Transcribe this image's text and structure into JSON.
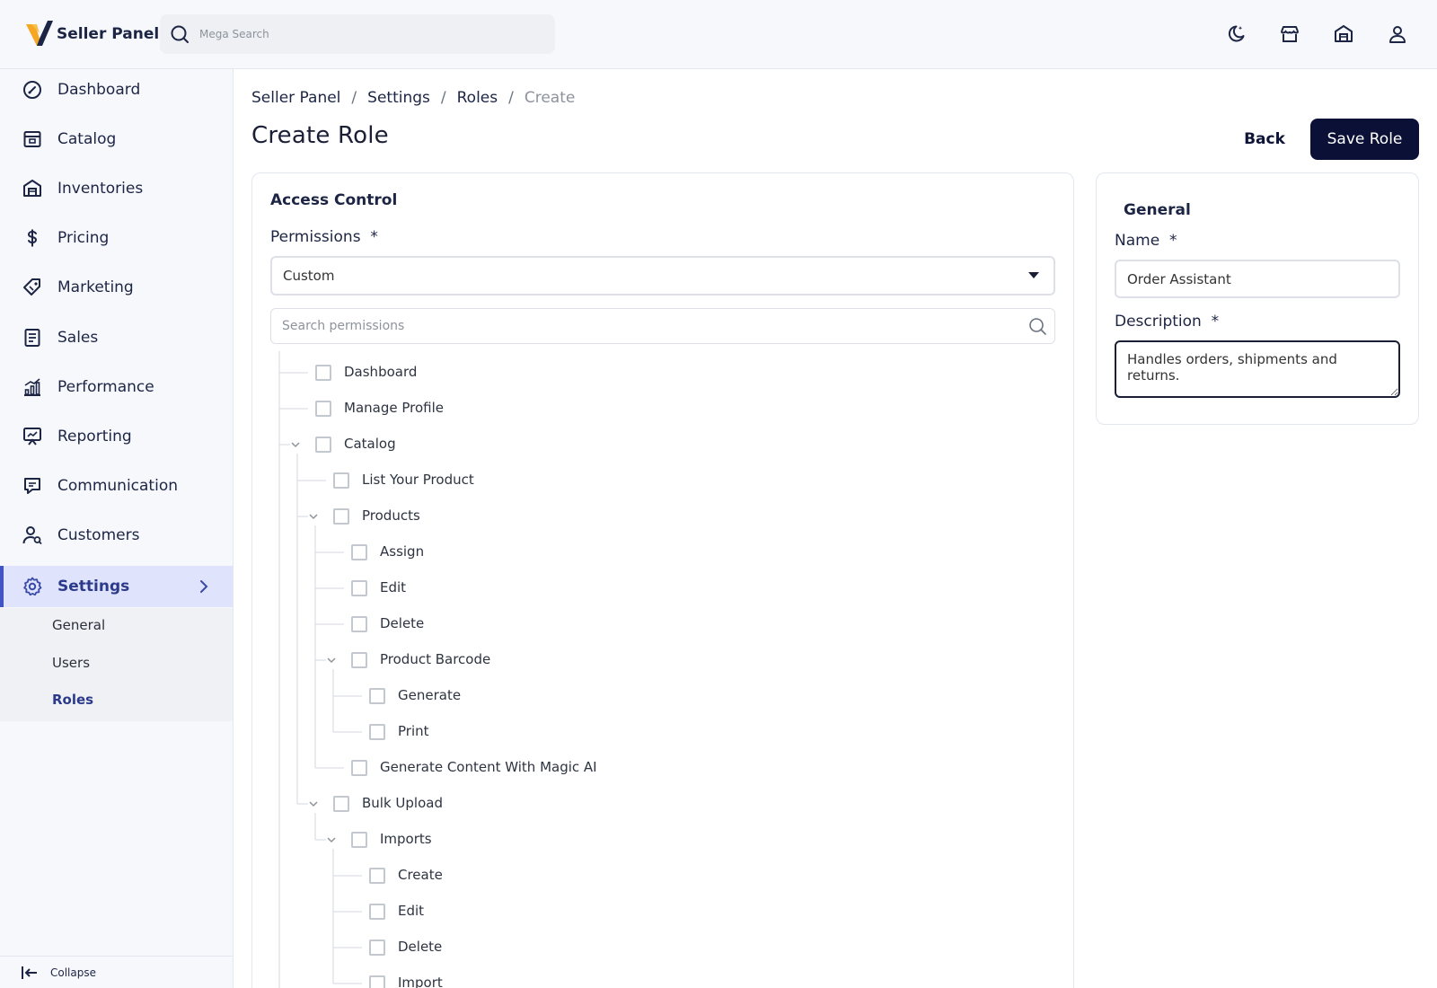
{
  "app": {
    "name": "Seller Panel"
  },
  "search": {
    "placeholder": "Mega Search"
  },
  "header_icons": [
    "moon-icon",
    "store-icon",
    "warehouse-icon",
    "user-icon"
  ],
  "colors": {
    "primary": "#0b1136",
    "accent": "#4154c4",
    "active_bg": "#dfe3fb"
  },
  "sidebar": {
    "items": [
      {
        "label": "Dashboard",
        "icon": "gauge-icon"
      },
      {
        "label": "Catalog",
        "icon": "catalog-icon"
      },
      {
        "label": "Inventories",
        "icon": "warehouse-icon"
      },
      {
        "label": "Pricing",
        "icon": "dollar-icon"
      },
      {
        "label": "Marketing",
        "icon": "tag-icon"
      },
      {
        "label": "Sales",
        "icon": "receipt-icon"
      },
      {
        "label": "Performance",
        "icon": "bar-chart-icon"
      },
      {
        "label": "Reporting",
        "icon": "presentation-icon"
      },
      {
        "label": "Communication",
        "icon": "chat-icon"
      },
      {
        "label": "Customers",
        "icon": "users-icon"
      },
      {
        "label": "Settings",
        "icon": "gear-icon",
        "active": true
      }
    ],
    "sub_items": [
      {
        "label": "General"
      },
      {
        "label": "Users"
      },
      {
        "label": "Roles",
        "active": true
      }
    ],
    "collapse_label": "Collapse"
  },
  "breadcrumb": [
    "Seller Panel",
    "Settings",
    "Roles",
    "Create"
  ],
  "page": {
    "title": "Create Role",
    "back_label": "Back",
    "save_label": "Save Role"
  },
  "access_control": {
    "title": "Access Control",
    "permissions_label": "Permissions",
    "required_mark": "*",
    "permissions_value": "Custom",
    "search_placeholder": "Search permissions",
    "tree": [
      {
        "label": "Dashboard",
        "depth": 0
      },
      {
        "label": "Manage Profile",
        "depth": 0
      },
      {
        "label": "Catalog",
        "depth": 0,
        "expanded": true
      },
      {
        "label": "List Your Product",
        "depth": 1
      },
      {
        "label": "Products",
        "depth": 1,
        "expanded": true
      },
      {
        "label": "Assign",
        "depth": 2
      },
      {
        "label": "Edit",
        "depth": 2
      },
      {
        "label": "Delete",
        "depth": 2
      },
      {
        "label": "Product Barcode",
        "depth": 2,
        "expanded": true
      },
      {
        "label": "Generate",
        "depth": 3
      },
      {
        "label": "Print",
        "depth": 3
      },
      {
        "label": "Generate Content With Magic AI",
        "depth": 2
      },
      {
        "label": "Bulk Upload",
        "depth": 1,
        "expanded": true
      },
      {
        "label": "Imports",
        "depth": 2,
        "expanded": true
      },
      {
        "label": "Create",
        "depth": 3
      },
      {
        "label": "Edit",
        "depth": 3
      },
      {
        "label": "Delete",
        "depth": 3
      },
      {
        "label": "Import",
        "depth": 3
      }
    ]
  },
  "general": {
    "title": "General",
    "name_label": "Name",
    "name_value": "Order Assistant",
    "description_label": "Description",
    "description_value": "Handles orders, shipments and returns."
  }
}
